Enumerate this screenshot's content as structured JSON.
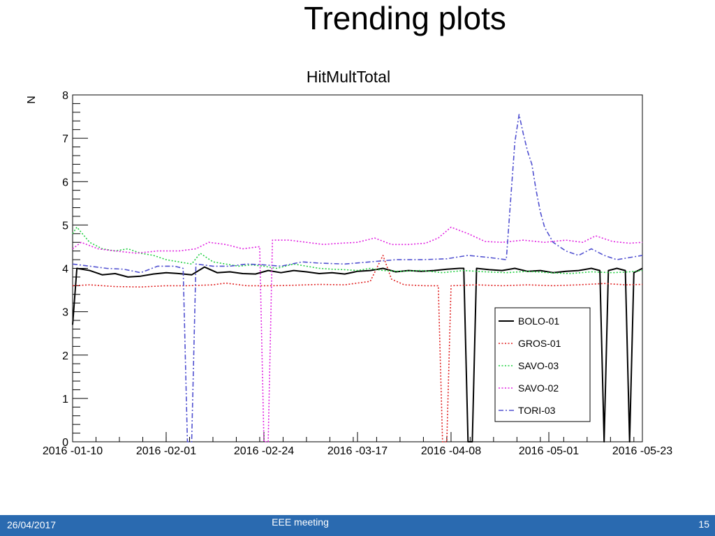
{
  "slide": {
    "title": "Trending plots",
    "footer_date": "26/04/2017",
    "footer_center": "EEE meeting",
    "page_number": "15"
  },
  "chart_data": {
    "type": "line",
    "title": "HitMultTotal",
    "ylabel": "N",
    "xlabel": "",
    "ylim": [
      0,
      8
    ],
    "y_ticks": [
      0,
      1,
      2,
      3,
      4,
      5,
      6,
      7,
      8
    ],
    "x_range": [
      "2016-01-10",
      "2016-05-23"
    ],
    "x_tick_labels": [
      "2016 -01-10",
      "2016 -02-01",
      "2016 -02-24",
      "2016 -03-17",
      "2016 -04-08",
      "2016 -05-01",
      "2016 -05-23"
    ],
    "x_tick_dates": [
      "2016-01-10",
      "2016-02-01",
      "2016-02-24",
      "2016-03-17",
      "2016-04-08",
      "2016-05-01",
      "2016-05-23"
    ],
    "legend_position": "bottom-right",
    "series": [
      {
        "name": "BOLO-01",
        "color": "#000000",
        "style": "solid",
        "points": [
          [
            "2016-01-10",
            2.7
          ],
          [
            "2016-01-11",
            4.0
          ],
          [
            "2016-01-14",
            3.95
          ],
          [
            "2016-01-17",
            3.85
          ],
          [
            "2016-01-20",
            3.88
          ],
          [
            "2016-01-23",
            3.8
          ],
          [
            "2016-01-26",
            3.82
          ],
          [
            "2016-01-29",
            3.87
          ],
          [
            "2016-02-01",
            3.9
          ],
          [
            "2016-02-04",
            3.88
          ],
          [
            "2016-02-07",
            3.85
          ],
          [
            "2016-02-10",
            4.03
          ],
          [
            "2016-02-13",
            3.9
          ],
          [
            "2016-02-16",
            3.92
          ],
          [
            "2016-02-19",
            3.88
          ],
          [
            "2016-02-22",
            3.87
          ],
          [
            "2016-02-25",
            3.95
          ],
          [
            "2016-02-28",
            3.9
          ],
          [
            "2016-03-02",
            3.95
          ],
          [
            "2016-03-05",
            3.92
          ],
          [
            "2016-03-08",
            3.88
          ],
          [
            "2016-03-11",
            3.9
          ],
          [
            "2016-03-14",
            3.87
          ],
          [
            "2016-03-17",
            3.93
          ],
          [
            "2016-03-20",
            3.95
          ],
          [
            "2016-03-23",
            4.0
          ],
          [
            "2016-03-26",
            3.92
          ],
          [
            "2016-03-29",
            3.95
          ],
          [
            "2016-04-01",
            3.93
          ],
          [
            "2016-04-04",
            3.95
          ],
          [
            "2016-04-07",
            3.98
          ],
          [
            "2016-04-10",
            4.0
          ],
          [
            "2016-04-11",
            4.0
          ],
          [
            "2016-04-12",
            0.0
          ],
          [
            "2016-04-13",
            0.0
          ],
          [
            "2016-04-14",
            4.0
          ],
          [
            "2016-04-17",
            3.97
          ],
          [
            "2016-04-20",
            3.95
          ],
          [
            "2016-04-23",
            4.0
          ],
          [
            "2016-04-26",
            3.93
          ],
          [
            "2016-04-29",
            3.95
          ],
          [
            "2016-05-02",
            3.9
          ],
          [
            "2016-05-05",
            3.93
          ],
          [
            "2016-05-08",
            3.95
          ],
          [
            "2016-05-11",
            4.0
          ],
          [
            "2016-05-13",
            3.95
          ],
          [
            "2016-05-14",
            0.0
          ],
          [
            "2016-05-15",
            3.95
          ],
          [
            "2016-05-17",
            4.0
          ],
          [
            "2016-05-19",
            3.95
          ],
          [
            "2016-05-20",
            0.0
          ],
          [
            "2016-05-21",
            3.9
          ],
          [
            "2016-05-22",
            3.95
          ],
          [
            "2016-05-23",
            4.0
          ]
        ]
      },
      {
        "name": "GROS-01",
        "color": "#e02020",
        "style": "dotted",
        "points": [
          [
            "2016-01-10",
            3.6
          ],
          [
            "2016-01-14",
            3.62
          ],
          [
            "2016-01-20",
            3.58
          ],
          [
            "2016-01-26",
            3.57
          ],
          [
            "2016-02-01",
            3.6
          ],
          [
            "2016-02-06",
            3.6
          ],
          [
            "2016-02-12",
            3.62
          ],
          [
            "2016-02-15",
            3.66
          ],
          [
            "2016-02-20",
            3.6
          ],
          [
            "2016-02-26",
            3.6
          ],
          [
            "2016-03-02",
            3.61
          ],
          [
            "2016-03-08",
            3.63
          ],
          [
            "2016-03-14",
            3.62
          ],
          [
            "2016-03-20",
            3.7
          ],
          [
            "2016-03-23",
            4.3
          ],
          [
            "2016-03-25",
            3.75
          ],
          [
            "2016-03-28",
            3.62
          ],
          [
            "2016-04-02",
            3.6
          ],
          [
            "2016-04-05",
            3.6
          ],
          [
            "2016-04-06",
            0.0
          ],
          [
            "2016-04-07",
            0.0
          ],
          [
            "2016-04-08",
            3.6
          ],
          [
            "2016-04-14",
            3.62
          ],
          [
            "2016-04-20",
            3.6
          ],
          [
            "2016-04-26",
            3.62
          ],
          [
            "2016-05-02",
            3.6
          ],
          [
            "2016-05-08",
            3.62
          ],
          [
            "2016-05-14",
            3.65
          ],
          [
            "2016-05-19",
            3.62
          ],
          [
            "2016-05-23",
            3.63
          ]
        ]
      },
      {
        "name": "SAVO-03",
        "color": "#20d040",
        "style": "dotted",
        "points": [
          [
            "2016-01-10",
            4.8
          ],
          [
            "2016-01-11",
            4.95
          ],
          [
            "2016-01-14",
            4.6
          ],
          [
            "2016-01-17",
            4.45
          ],
          [
            "2016-01-20",
            4.4
          ],
          [
            "2016-01-23",
            4.45
          ],
          [
            "2016-01-26",
            4.35
          ],
          [
            "2016-01-29",
            4.3
          ],
          [
            "2016-02-01",
            4.2
          ],
          [
            "2016-02-04",
            4.15
          ],
          [
            "2016-02-07",
            4.1
          ],
          [
            "2016-02-09",
            4.35
          ],
          [
            "2016-02-12",
            4.15
          ],
          [
            "2016-02-15",
            4.1
          ],
          [
            "2016-02-18",
            4.05
          ],
          [
            "2016-02-21",
            4.08
          ],
          [
            "2016-02-24",
            4.05
          ],
          [
            "2016-02-27",
            4.0
          ],
          [
            "2016-03-02",
            4.1
          ],
          [
            "2016-03-05",
            4.05
          ],
          [
            "2016-03-08",
            4.0
          ],
          [
            "2016-03-11",
            3.98
          ],
          [
            "2016-03-14",
            3.97
          ],
          [
            "2016-03-17",
            3.95
          ],
          [
            "2016-03-20",
            4.0
          ],
          [
            "2016-03-23",
            3.95
          ],
          [
            "2016-03-27",
            3.93
          ],
          [
            "2016-04-01",
            3.95
          ],
          [
            "2016-04-06",
            3.9
          ],
          [
            "2016-04-11",
            3.95
          ],
          [
            "2016-04-16",
            3.92
          ],
          [
            "2016-04-21",
            3.9
          ],
          [
            "2016-04-26",
            3.93
          ],
          [
            "2016-05-01",
            3.9
          ],
          [
            "2016-05-06",
            3.88
          ],
          [
            "2016-05-11",
            3.92
          ],
          [
            "2016-05-16",
            3.9
          ],
          [
            "2016-05-20",
            3.92
          ],
          [
            "2016-05-23",
            3.95
          ]
        ]
      },
      {
        "name": "SAVO-02",
        "color": "#e020e0",
        "style": "dotted",
        "points": [
          [
            "2016-01-10",
            4.45
          ],
          [
            "2016-01-12",
            4.6
          ],
          [
            "2016-01-16",
            4.45
          ],
          [
            "2016-01-20",
            4.4
          ],
          [
            "2016-01-25",
            4.35
          ],
          [
            "2016-01-30",
            4.4
          ],
          [
            "2016-02-04",
            4.4
          ],
          [
            "2016-02-08",
            4.45
          ],
          [
            "2016-02-11",
            4.6
          ],
          [
            "2016-02-15",
            4.55
          ],
          [
            "2016-02-19",
            4.45
          ],
          [
            "2016-02-23",
            4.5
          ],
          [
            "2016-02-24",
            0.0
          ],
          [
            "2016-02-25",
            0.0
          ],
          [
            "2016-02-26",
            4.65
          ],
          [
            "2016-03-01",
            4.65
          ],
          [
            "2016-03-05",
            4.6
          ],
          [
            "2016-03-09",
            4.55
          ],
          [
            "2016-03-13",
            4.58
          ],
          [
            "2016-03-17",
            4.6
          ],
          [
            "2016-03-21",
            4.7
          ],
          [
            "2016-03-25",
            4.55
          ],
          [
            "2016-03-29",
            4.55
          ],
          [
            "2016-04-02",
            4.58
          ],
          [
            "2016-04-05",
            4.7
          ],
          [
            "2016-04-08",
            4.95
          ],
          [
            "2016-04-12",
            4.8
          ],
          [
            "2016-04-16",
            4.62
          ],
          [
            "2016-04-20",
            4.6
          ],
          [
            "2016-04-25",
            4.65
          ],
          [
            "2016-04-30",
            4.6
          ],
          [
            "2016-05-05",
            4.65
          ],
          [
            "2016-05-09",
            4.6
          ],
          [
            "2016-05-12",
            4.75
          ],
          [
            "2016-05-16",
            4.62
          ],
          [
            "2016-05-20",
            4.58
          ],
          [
            "2016-05-23",
            4.6
          ]
        ]
      },
      {
        "name": "TORI-03",
        "color": "#5050d0",
        "style": "dashdot",
        "points": [
          [
            "2016-01-10",
            4.1
          ],
          [
            "2016-01-14",
            4.05
          ],
          [
            "2016-01-18",
            4.0
          ],
          [
            "2016-01-22",
            3.98
          ],
          [
            "2016-01-26",
            3.9
          ],
          [
            "2016-01-30",
            4.05
          ],
          [
            "2016-02-03",
            4.05
          ],
          [
            "2016-02-05",
            4.0
          ],
          [
            "2016-02-06",
            0.0
          ],
          [
            "2016-02-07",
            0.0
          ],
          [
            "2016-02-08",
            4.1
          ],
          [
            "2016-02-12",
            4.05
          ],
          [
            "2016-02-16",
            4.05
          ],
          [
            "2016-02-20",
            4.1
          ],
          [
            "2016-02-24",
            4.08
          ],
          [
            "2016-02-28",
            4.05
          ],
          [
            "2016-03-04",
            4.15
          ],
          [
            "2016-03-08",
            4.12
          ],
          [
            "2016-03-14",
            4.1
          ],
          [
            "2016-03-20",
            4.15
          ],
          [
            "2016-03-26",
            4.2
          ],
          [
            "2016-04-01",
            4.2
          ],
          [
            "2016-04-07",
            4.22
          ],
          [
            "2016-04-12",
            4.3
          ],
          [
            "2016-04-17",
            4.25
          ],
          [
            "2016-04-21",
            4.2
          ],
          [
            "2016-04-23",
            6.9
          ],
          [
            "2016-04-24",
            7.55
          ],
          [
            "2016-04-25",
            7.1
          ],
          [
            "2016-04-26",
            6.7
          ],
          [
            "2016-04-27",
            6.4
          ],
          [
            "2016-04-28",
            5.8
          ],
          [
            "2016-04-29",
            5.3
          ],
          [
            "2016-04-30",
            4.95
          ],
          [
            "2016-05-02",
            4.6
          ],
          [
            "2016-05-05",
            4.4
          ],
          [
            "2016-05-08",
            4.3
          ],
          [
            "2016-05-11",
            4.45
          ],
          [
            "2016-05-14",
            4.3
          ],
          [
            "2016-05-17",
            4.2
          ],
          [
            "2016-05-20",
            4.25
          ],
          [
            "2016-05-23",
            4.3
          ]
        ]
      }
    ]
  }
}
